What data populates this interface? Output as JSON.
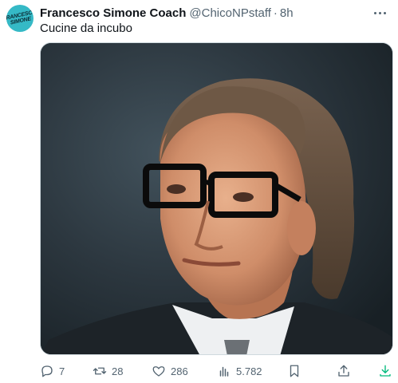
{
  "tweet": {
    "display_name": "Francesco Simone Coach",
    "handle": "@ChicoNPstaff",
    "separator": "·",
    "time": "8h",
    "text": "Cucine da incubo",
    "avatar_logo": "FRANCESCO SIMONE"
  },
  "actions": {
    "replies": "7",
    "reposts": "28",
    "likes": "286",
    "views": "5.782"
  },
  "colors": {
    "accent": "#00ba7c",
    "muted": "#536471",
    "avatar_bg": "#35b9c6"
  }
}
